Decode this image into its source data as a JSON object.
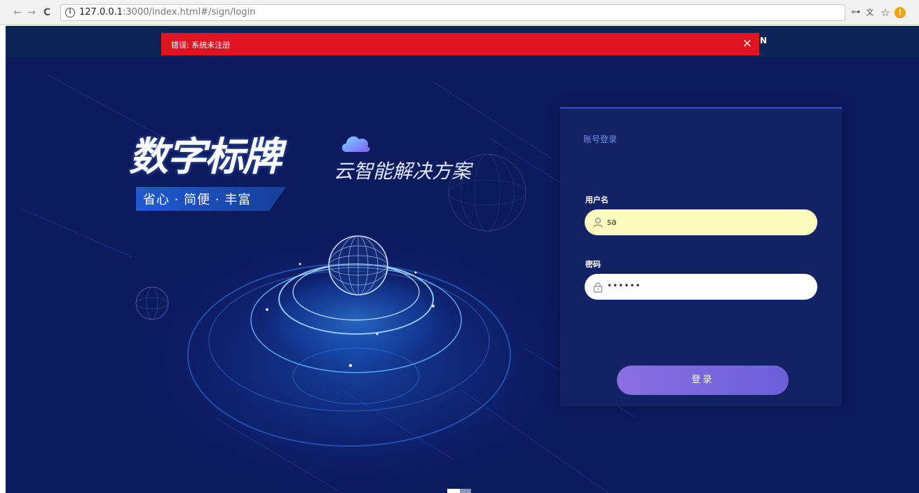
{
  "browser": {
    "url_host": "127.0.0.1",
    "url_rest": ":3000/index.html#/sign/login",
    "back_icon": "←",
    "forward_icon": "→",
    "reload_icon": "C",
    "info_icon": "i",
    "key_icon": "⊶",
    "translate_icon": "文",
    "star_icon": "☆",
    "alert_icon": "!"
  },
  "topbar": {
    "label": "N"
  },
  "toast": {
    "message": "错误: 系统未注册",
    "close_icon": "×"
  },
  "hero": {
    "title": "数字标牌",
    "subtitle": "云智能解决方案",
    "tagline": "省心 · 简便 · 丰富"
  },
  "login": {
    "title": "账号登录",
    "username_label": "用户名",
    "username_value": "sa",
    "password_label": "密码",
    "password_value": "••••••",
    "submit_label": "登录"
  },
  "colors": {
    "page_bg": "#0c1a5e",
    "toast_bg": "#e0141e",
    "card_accent": "#3550d6",
    "button_gradient_start": "#8a6fe2",
    "button_gradient_end": "#6b5fd8"
  }
}
